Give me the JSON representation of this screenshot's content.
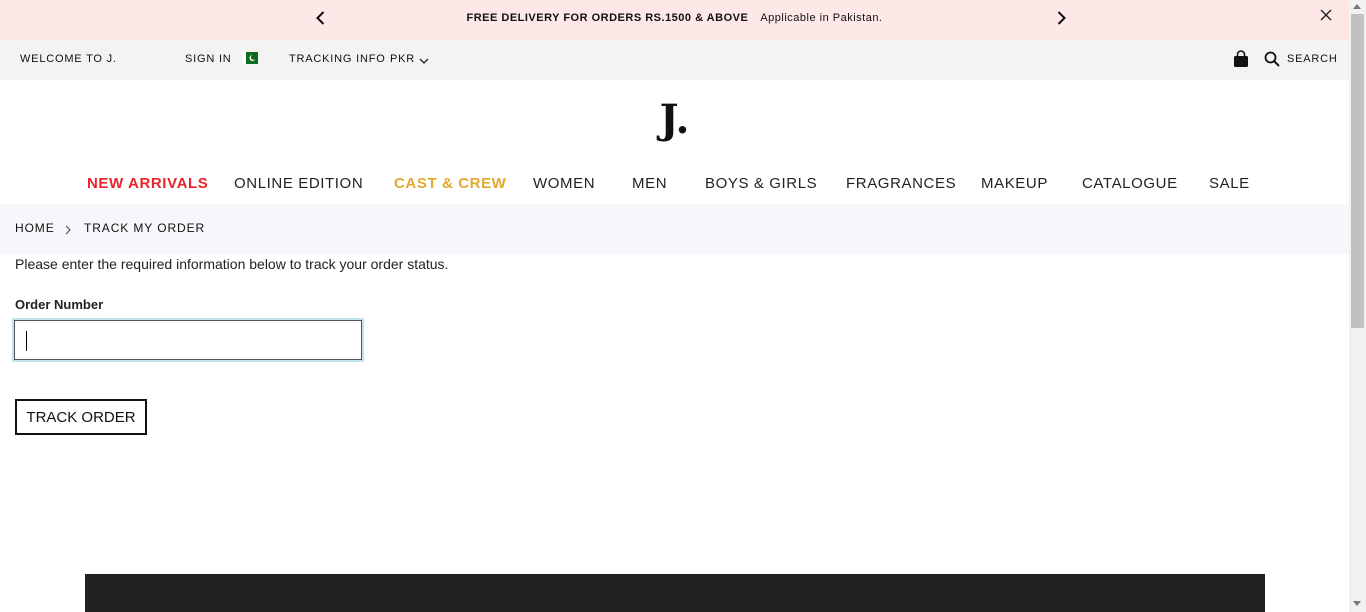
{
  "announcement": {
    "headline": "FREE DELIVERY FOR ORDERS RS.1500 & ABOVE",
    "subtext": "Applicable in Pakistan.",
    "prev_icon": "chevron-left-icon",
    "next_icon": "chevron-right-icon",
    "close_icon": "close-icon"
  },
  "utility": {
    "welcome": "WELCOME TO J.",
    "sign_in": "SIGN IN",
    "tracking": "TRACKING INFO",
    "currency": "PKR",
    "search": "SEARCH",
    "flag_icon": "pakistan-flag-icon",
    "bag_icon": "shopping-bag-icon",
    "search_icon": "search-icon"
  },
  "brand": {
    "logo": "J."
  },
  "nav": {
    "items": [
      {
        "label": "NEW ARRIVALS",
        "color": "#e8242c"
      },
      {
        "label": "ONLINE EDITION",
        "color": "#222222"
      },
      {
        "label": "CAST & CREW",
        "color": "#e1a92d"
      },
      {
        "label": "WOMEN",
        "color": "#222222"
      },
      {
        "label": "MEN",
        "color": "#222222"
      },
      {
        "label": "BOYS & GIRLS",
        "color": "#222222"
      },
      {
        "label": "FRAGRANCES",
        "color": "#222222"
      },
      {
        "label": "MAKEUP",
        "color": "#222222"
      },
      {
        "label": "CATALOGUE",
        "color": "#222222"
      },
      {
        "label": "SALE",
        "color": "#222222"
      }
    ]
  },
  "breadcrumb": {
    "home": "HOME",
    "current": "TRACK MY ORDER"
  },
  "form": {
    "intro": "Please enter the required information below to track your order status.",
    "order_label": "Order Number",
    "order_value": "",
    "button": "TRACK ORDER"
  },
  "colors": {
    "announce_bg": "#fde7e7",
    "util_bg": "#f3f3f3",
    "breadcrumb_bg": "#f7f6fa",
    "footer_bg": "#222222",
    "input_focus": "#bfe3ee"
  }
}
